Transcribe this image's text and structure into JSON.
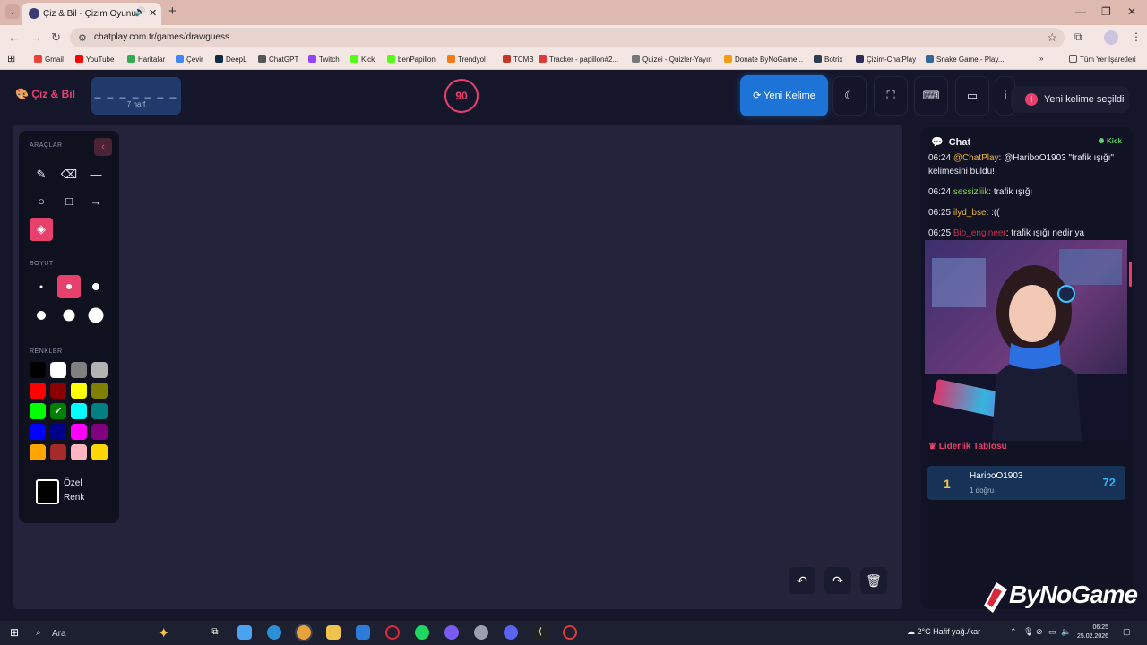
{
  "browser": {
    "tab_title": "Çiz & Bil - Çizim Oyunu",
    "url": "chatplay.com.tr/games/drawguess",
    "bookmarks": [
      "Gmail",
      "YouTube",
      "Haritalar",
      "Çevir",
      "DeepL",
      "ChatGPT",
      "Twitch",
      "Kick",
      "benPapillon",
      "Trendyol",
      "TCMB",
      "Tracker - papillon#2...",
      "Quizei - Quizler-Yayın",
      "Donate ByNoGame...",
      "Botrix",
      "Çizim-ChatPlay",
      "Snake Game - Play..."
    ],
    "all_bookmarks": "Tüm Yer İşaretleri",
    "bookmark_colors": [
      "#ea4335",
      "#ff0000",
      "#34a853",
      "#4285f4",
      "#0f2b46",
      "#555555",
      "#9146ff",
      "#53fc18",
      "#53fc18",
      "#f27a1a",
      "#c0392b",
      "#e03a3a",
      "#777777",
      "#f39c12",
      "#2c3e50",
      "#2c2c54",
      "#336699"
    ]
  },
  "header": {
    "logo": "Çiz & Bil",
    "word_mask": "_ _ _ _ _ _ _",
    "word_hint": "7 harf",
    "timer": "90",
    "new_word_label": "Yeni Kelime",
    "toast": "Yeni kelime seçildi",
    "icons": [
      "moon-icon",
      "fullscreen-icon",
      "keyboard-icon",
      "archive-icon",
      "info-icon"
    ]
  },
  "tools": {
    "section_tools": "ARAÇLAR",
    "section_size": "BOYUT",
    "section_colors": "RENKLER",
    "custom_color_label": "Özel Renk",
    "tool_items": [
      "pencil",
      "eraser",
      "line",
      "circle",
      "rectangle",
      "arrow",
      "fill"
    ],
    "active_tool": "fill",
    "size_count": 6,
    "active_size": 2,
    "colors": [
      "#000000",
      "#ffffff",
      "#808080",
      "#b3b3b3",
      "#ff0000",
      "#8b0000",
      "#ffff00",
      "#808000",
      "#00ff00",
      "#008000",
      "#00ffff",
      "#008080",
      "#0000ff",
      "#00008b",
      "#ff00ff",
      "#800080",
      "#ffa500",
      "#a52a2a",
      "#ffb6c1",
      "#ffd700"
    ],
    "selected_color": "#008000",
    "custom_color": "#000000"
  },
  "chat": {
    "title": "Chat",
    "platform": "Kick",
    "messages": [
      {
        "time": "06:24",
        "user": "@ChatPlay",
        "text": ": @HariboO1903 \"trafik ışığı\" kelimesini buldu!",
        "color": "#f0b429"
      },
      {
        "time": "06:24",
        "user": "sessizliik",
        "text": ": trafik ışığı",
        "color": "#7fd650"
      },
      {
        "time": "06:25",
        "user": "ilyd_bse",
        "text": ": :((",
        "color": "#f0b429"
      },
      {
        "time": "06:25",
        "user": "Bio_engineer",
        "text": ": trafik ışığı nedir ya",
        "color": "#c4304e"
      }
    ]
  },
  "leaderboard": {
    "title": "Liderlik Tablosu",
    "rows": [
      {
        "rank": "1",
        "name": "HariboO1903",
        "sub": "1 doğru",
        "score": "72"
      }
    ]
  },
  "watermark": "ByNoGame",
  "taskbar": {
    "search": "Ara",
    "weather": "2°C  Hafif yağ./kar",
    "time": "06:25",
    "date": "25.02.2026"
  }
}
